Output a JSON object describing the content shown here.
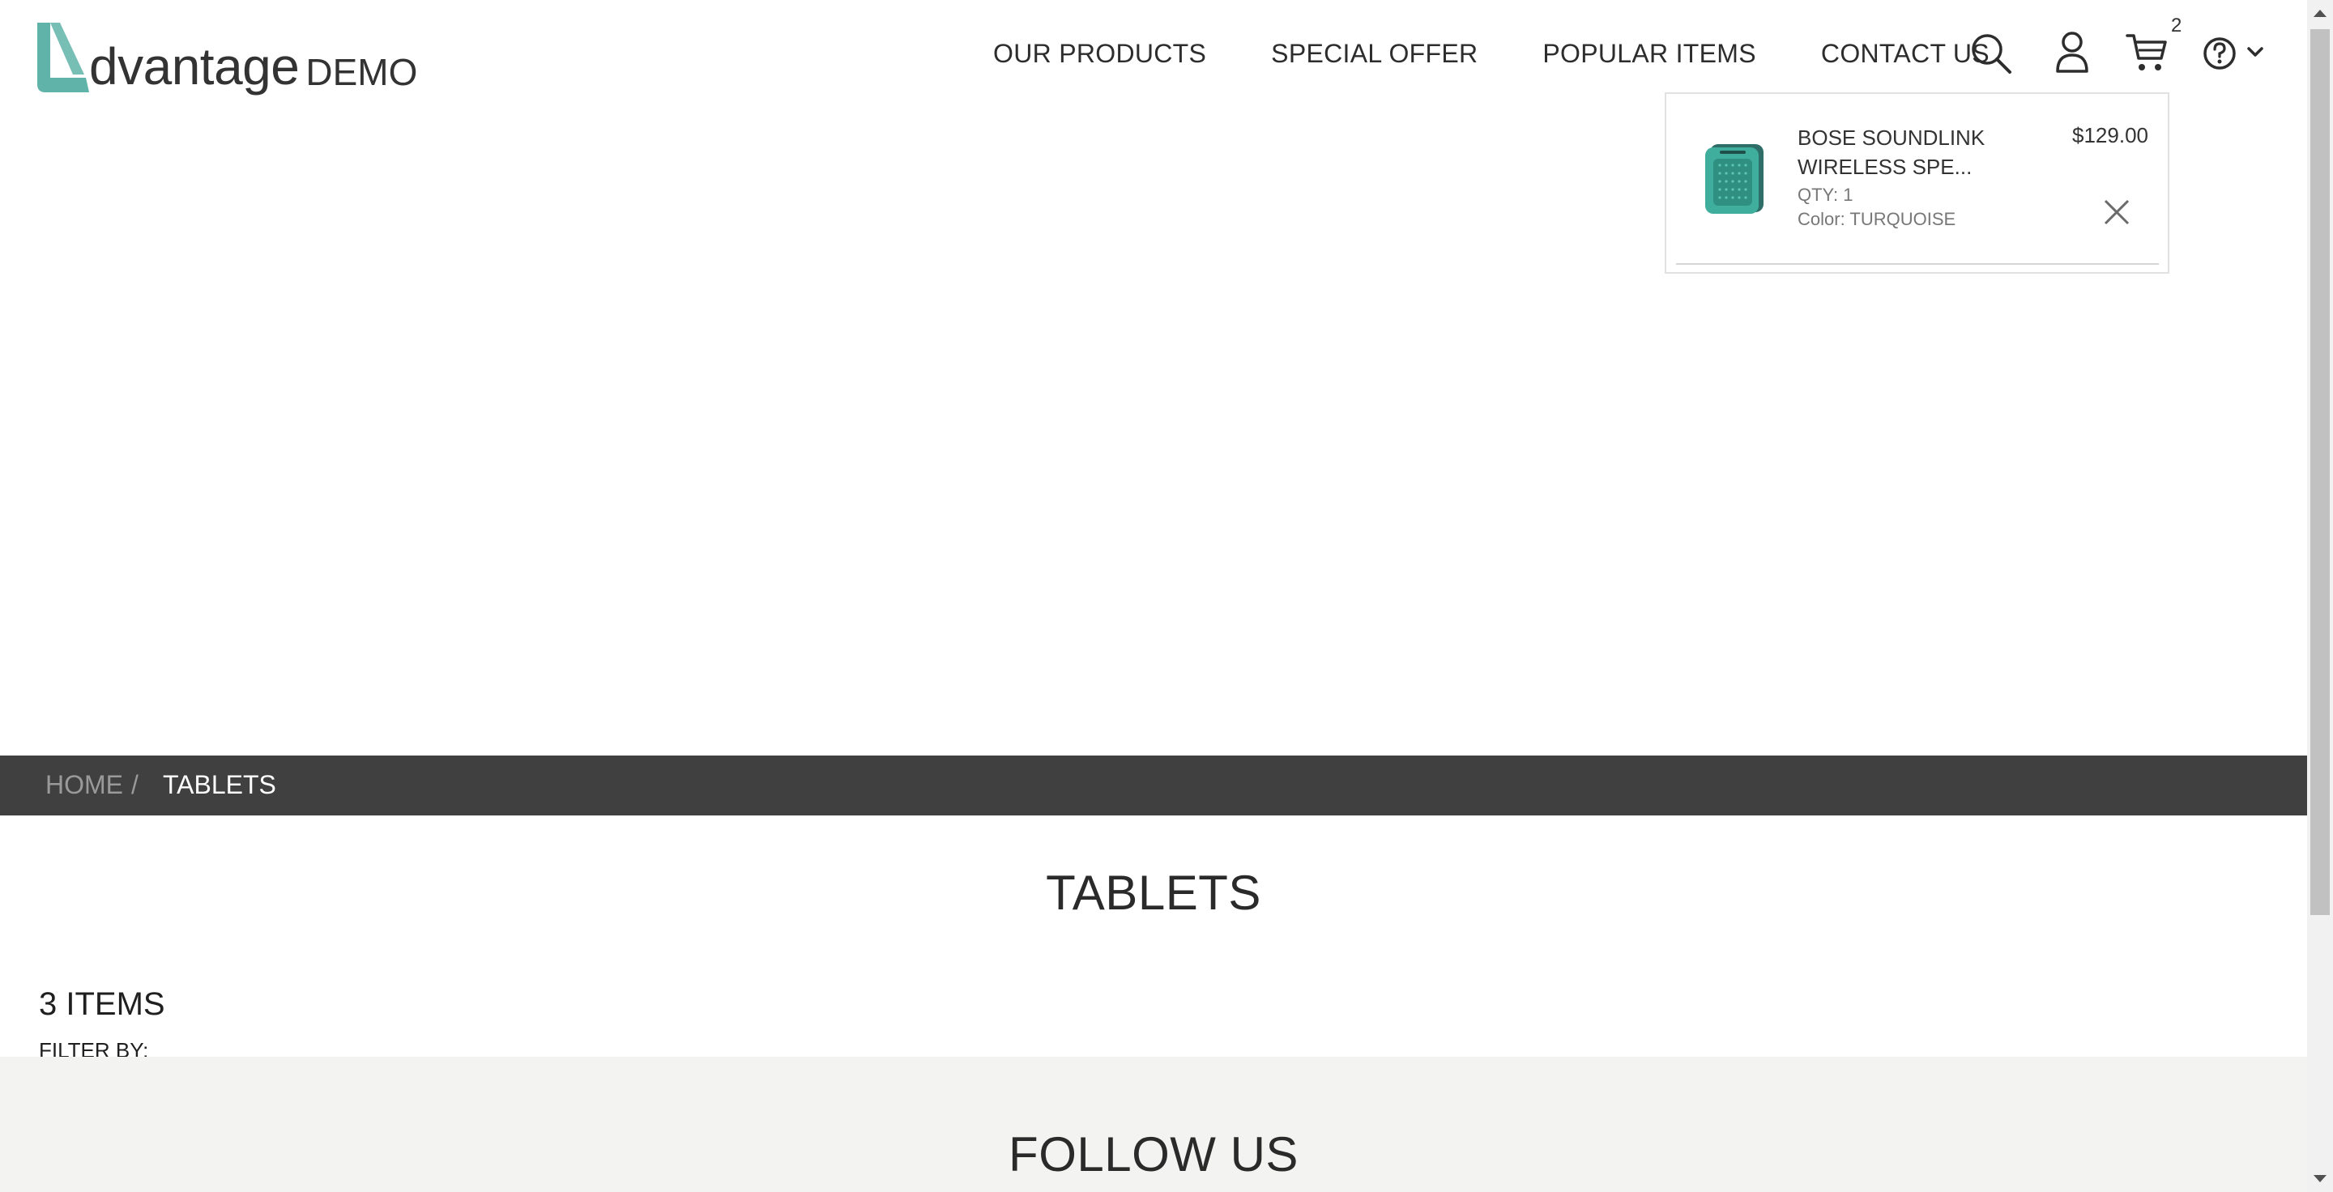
{
  "logo": {
    "word": "dvantage",
    "suffix": "DEMO"
  },
  "nav": {
    "items": [
      {
        "label": "OUR PRODUCTS"
      },
      {
        "label": "SPECIAL OFFER"
      },
      {
        "label": "POPULAR ITEMS"
      },
      {
        "label": "CONTACT US"
      }
    ]
  },
  "header_icons": {
    "search": "search-icon",
    "user": "user-icon",
    "cart": "cart-icon",
    "help": "help-icon",
    "cart_count": "2"
  },
  "mini_cart": {
    "item": {
      "name": "BOSE SOUNDLINK WIRELESS SPE...",
      "qty": "QTY: 1",
      "color": "Color: TURQUOISE",
      "price": "$129.00",
      "thumb_color": "#3fae9c"
    }
  },
  "breadcrumb": {
    "home": "HOME",
    "separator": "/",
    "current": "TABLETS"
  },
  "category": {
    "title": "TABLETS",
    "items_count": "3 ITEMS",
    "filter_label": "FILTER BY:"
  },
  "footer": {
    "follow_title": "FOLLOW US"
  },
  "colors": {
    "brand_teal": "#5fb3a8",
    "breadcrumb_bg": "#404040",
    "footer_bg": "#f3f3f1"
  }
}
